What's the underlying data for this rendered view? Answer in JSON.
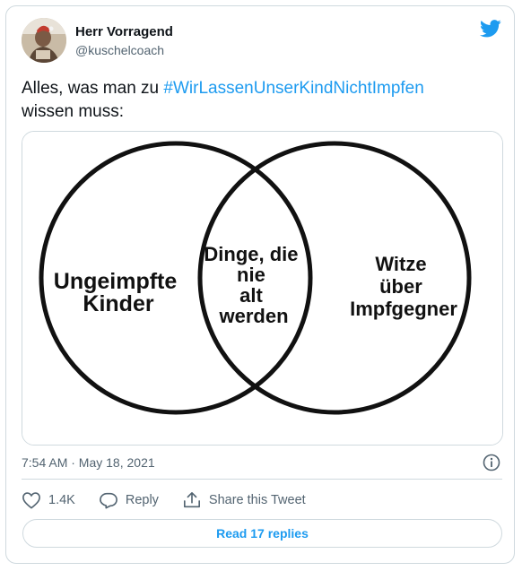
{
  "author": {
    "name": "Herr Vorragend",
    "handle": "@kuschelcoach"
  },
  "tweet": {
    "text_before": "Alles, was man zu ",
    "hashtag": "#WirLassenUnserKindNichtImpfen",
    "text_after": "wissen muss:"
  },
  "venn": {
    "left_lines": [
      "Ungeimpfte",
      "Kinder"
    ],
    "middle_lines": [
      "Dinge, die",
      "nie",
      "alt",
      "werden"
    ],
    "right_lines": [
      "Witze",
      "über",
      "Impfgegner"
    ]
  },
  "meta": {
    "timestamp": "7:54 AM · May 18, 2021"
  },
  "actions": {
    "likes": "1.4K",
    "reply_label": "Reply",
    "share_label": "Share this Tweet"
  },
  "read_replies_label": "Read 17 replies",
  "colors": {
    "accent": "#1d9bf0",
    "border": "#cfd9de",
    "muted": "#536471"
  }
}
